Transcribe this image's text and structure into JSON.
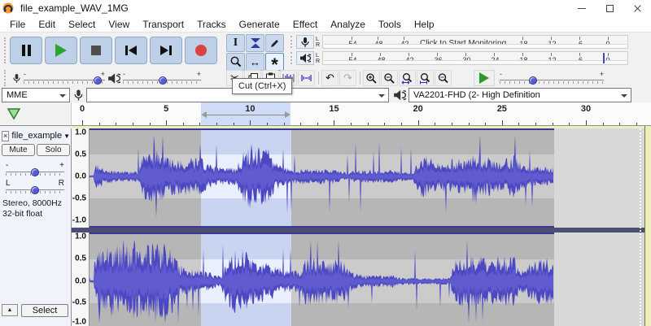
{
  "window": {
    "title": "file_example_WAV_1MG"
  },
  "menu": {
    "items": [
      "File",
      "Edit",
      "Select",
      "View",
      "Transport",
      "Tracks",
      "Generate",
      "Effect",
      "Analyze",
      "Tools",
      "Help"
    ]
  },
  "transport": {
    "buttons": [
      "pause",
      "play",
      "stop",
      "skip-to-start",
      "skip-to-end",
      "record"
    ]
  },
  "tools": {
    "buttons": [
      "selection-tool",
      "envelope-tool",
      "draw-tool",
      "zoom-tool",
      "time-shift-tool",
      "multi-tool"
    ],
    "selected": "multi-tool"
  },
  "meters": {
    "channel_labels": [
      "L",
      "R"
    ],
    "record": {
      "scale": [
        "-54",
        "-48",
        "-42",
        "-18",
        "-12",
        "-6",
        "0"
      ],
      "monitor_text": "Click to Start Monitoring"
    },
    "play": {
      "scale": [
        "-54",
        "-48",
        "-42",
        "-36",
        "-30",
        "-24",
        "-18",
        "-12",
        "-6",
        "0"
      ]
    }
  },
  "mixer": {
    "minus": "-",
    "plus": "+",
    "record_volume_pct": 92,
    "playback_volume_pct": 50
  },
  "edit_toolbar": {
    "buttons": [
      "cut",
      "copy",
      "paste",
      "trim-outside-selection",
      "silence-selection",
      "undo",
      "redo",
      "zoom-in",
      "zoom-out",
      "fit-selection",
      "fit-project",
      "zoom-toggle"
    ],
    "redo_disabled": true
  },
  "speed_toolbar": {
    "play_at_speed_pct": 30
  },
  "tooltip": {
    "text": "Cut (Ctrl+X)"
  },
  "devices": {
    "host": "MME",
    "recording_device": "",
    "playback_device": "VA2201-FHD (2- High Definition"
  },
  "timeline": {
    "tick_labels": [
      "0",
      "5",
      "10",
      "15",
      "20",
      "25",
      "30"
    ],
    "selection_start_s": 7.1,
    "selection_end_s": 12.4
  },
  "track": {
    "close": "×",
    "name": "file_example",
    "menu_arrow": "▼",
    "mute": "Mute",
    "solo": "Solo",
    "gain_min": "-",
    "gain_max": "+",
    "pan_left": "L",
    "pan_right": "R",
    "info1": "Stereo, 8000Hz",
    "info2": "32-bit float",
    "collapse": "▲",
    "select": "Select",
    "scale_labels": [
      "1.0",
      "0.5",
      "0.0",
      "-0.5",
      "-1.0"
    ],
    "clip_end_s": 28.1
  },
  "icons": {
    "audacity-logo": "orange circle with blue headphones",
    "pause": "two vertical bars",
    "play": "green right triangle",
    "stop": "gray square",
    "skip-to-start": "bar + left triangle",
    "skip-to-end": "right triangle + bar",
    "record": "red circle",
    "mic": "microphone",
    "speaker": "loudspeaker with waves",
    "selection-tool": "I-beam",
    "envelope-tool": "two facing triangles",
    "draw-tool": "pencil",
    "zoom-tool": "magnifier",
    "time-shift-tool": "↔",
    "multi-tool": "*",
    "cut": "scissors",
    "copy": "two pages",
    "paste": "clipboard",
    "trim-outside-selection": "blue waveform in brackets",
    "silence-selection": "blue waveform flattened",
    "undo": "↶",
    "redo": "↷",
    "zoom-in": "magnifier +",
    "zoom-out": "magnifier −",
    "fit-selection": "magnifier ↔",
    "fit-project": "magnifier ⊣⊢",
    "zoom-toggle": "magnifier",
    "monitor-playhead": "green down triangle",
    "combo-chevron": "down triangle",
    "minimize": "–",
    "maximize": "□",
    "close": "×"
  },
  "colors": {
    "waveform": "#4b48c2",
    "waveform_rms": "#605cd0",
    "band_dark": "#b6b6b6",
    "band_light": "#cbcbcb",
    "sel_dark": "#c8d4f0",
    "sel_light": "#e9effd",
    "separator": "#4c4e74",
    "clip_border": "#3a3890",
    "focus_border": "#eef0bc",
    "button_blue": "#bdd0e8",
    "play_green": "#2ba52b",
    "record_red": "#da4242",
    "ruler_selection": "#cfdcf8"
  }
}
